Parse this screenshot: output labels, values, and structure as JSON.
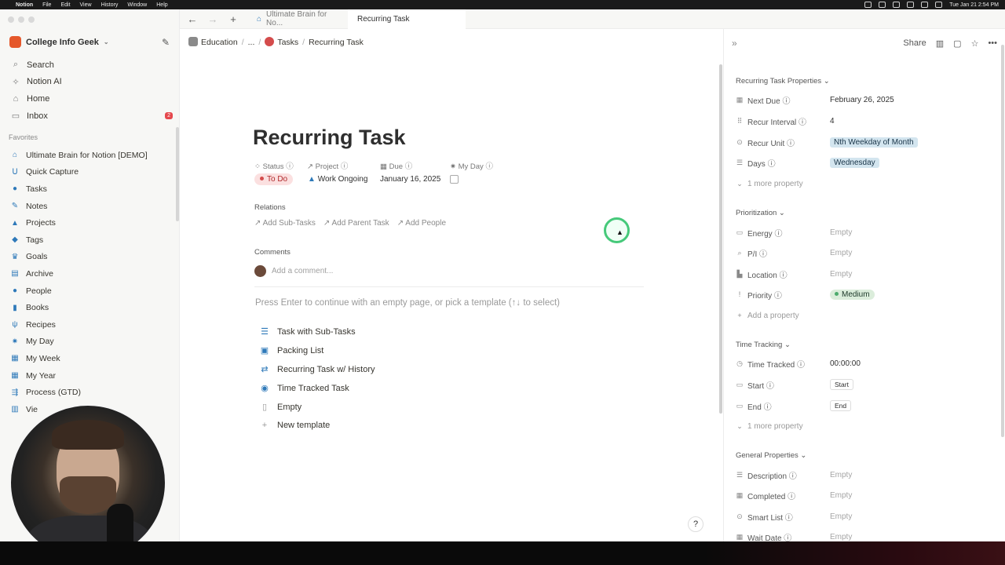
{
  "menubar": {
    "app": "Notion",
    "items": [
      "File",
      "Edit",
      "View",
      "History",
      "Window",
      "Help"
    ],
    "clock": "Tue Jan 21  2:54 PM"
  },
  "tabs": [
    {
      "label": "Ultimate Brain for No..."
    },
    {
      "label": "Recurring Task"
    }
  ],
  "sidebar": {
    "workspace": "College Info Geek",
    "nav": [
      {
        "label": "Search",
        "icon": "search-icon"
      },
      {
        "label": "Notion AI",
        "icon": "ai-icon"
      },
      {
        "label": "Home",
        "icon": "home-icon"
      },
      {
        "label": "Inbox",
        "icon": "inbox-icon",
        "badge": "2"
      }
    ],
    "favorites_label": "Favorites",
    "favorites": [
      {
        "label": "Ultimate Brain for Notion [DEMO]",
        "icon": "house-icon"
      },
      {
        "label": "Quick Capture",
        "icon": "magnet-icon"
      },
      {
        "label": "Tasks",
        "icon": "check-circle-icon"
      },
      {
        "label": "Notes",
        "icon": "note-icon"
      },
      {
        "label": "Projects",
        "icon": "rocket-icon"
      },
      {
        "label": "Tags",
        "icon": "tag-icon"
      },
      {
        "label": "Goals",
        "icon": "trophy-icon"
      },
      {
        "label": "Archive",
        "icon": "archive-icon"
      },
      {
        "label": "People",
        "icon": "person-icon"
      },
      {
        "label": "Books",
        "icon": "book-icon"
      },
      {
        "label": "Recipes",
        "icon": "utensils-icon"
      },
      {
        "label": "My Day",
        "icon": "sun-icon"
      },
      {
        "label": "My Week",
        "icon": "calendar-icon"
      },
      {
        "label": "My Year",
        "icon": "calendar-icon"
      },
      {
        "label": "Process (GTD)",
        "icon": "flow-icon"
      },
      {
        "label": "Vie",
        "icon": "view-icon"
      }
    ]
  },
  "breadcrumb": {
    "root": "Education",
    "ellipsis": "...",
    "parent": "Tasks",
    "current": "Recurring Task"
  },
  "page": {
    "title": "Recurring Task",
    "props": {
      "status_label": "Status",
      "status_value": "To Do",
      "project_label": "Project",
      "project_value": "Work Ongoing",
      "due_label": "Due",
      "due_value": "January 16, 2025",
      "myday_label": "My Day"
    },
    "relations_label": "Relations",
    "relations": [
      "Add Sub-Tasks",
      "Add Parent Task",
      "Add People"
    ],
    "comments_label": "Comments",
    "comment_placeholder": "Add a comment...",
    "hint": "Press Enter to continue with an empty page, or pick a template (↑↓ to select)",
    "templates": [
      {
        "label": "Task with Sub-Tasks",
        "icon": "list-icon"
      },
      {
        "label": "Packing List",
        "icon": "suitcase-icon"
      },
      {
        "label": "Recurring Task w/ History",
        "icon": "repeat-icon"
      },
      {
        "label": "Time Tracked Task",
        "icon": "stopwatch-icon"
      },
      {
        "label": "Empty",
        "icon": "page-icon"
      },
      {
        "label": "New template",
        "icon": "plus-icon"
      }
    ]
  },
  "panel": {
    "share": "Share",
    "recurring": {
      "header": "Recurring Task Properties",
      "rows": [
        {
          "label": "Next Due",
          "value": "February 26, 2025"
        },
        {
          "label": "Recur Interval",
          "value": "4"
        },
        {
          "label": "Recur Unit",
          "value": "Nth Weekday of Month"
        },
        {
          "label": "Days",
          "value": "Wednesday"
        }
      ],
      "more": "1 more property"
    },
    "prioritization": {
      "header": "Prioritization",
      "rows": [
        {
          "label": "Energy",
          "value": "Empty"
        },
        {
          "label": "P/I",
          "value": "Empty"
        },
        {
          "label": "Location",
          "value": "Empty"
        },
        {
          "label": "Priority",
          "value": "Medium"
        }
      ],
      "add": "Add a property"
    },
    "time": {
      "header": "Time Tracking",
      "rows": [
        {
          "label": "Time Tracked",
          "value": "00:00:00"
        },
        {
          "label": "Start",
          "value": "Start"
        },
        {
          "label": "End",
          "value": "End"
        }
      ],
      "more": "1 more property"
    },
    "general": {
      "header": "General Properties",
      "rows": [
        {
          "label": "Description",
          "value": "Empty"
        },
        {
          "label": "Completed",
          "value": "Empty"
        },
        {
          "label": "Smart List",
          "value": "Empty"
        },
        {
          "label": "Wait Date",
          "value": "Empty"
        }
      ]
    }
  },
  "colors": {
    "accent_blue": "#2e79b9",
    "status_red": "#d44c4c",
    "priority_green": "#4dab6d",
    "cursor_ring": "#46c97a"
  }
}
